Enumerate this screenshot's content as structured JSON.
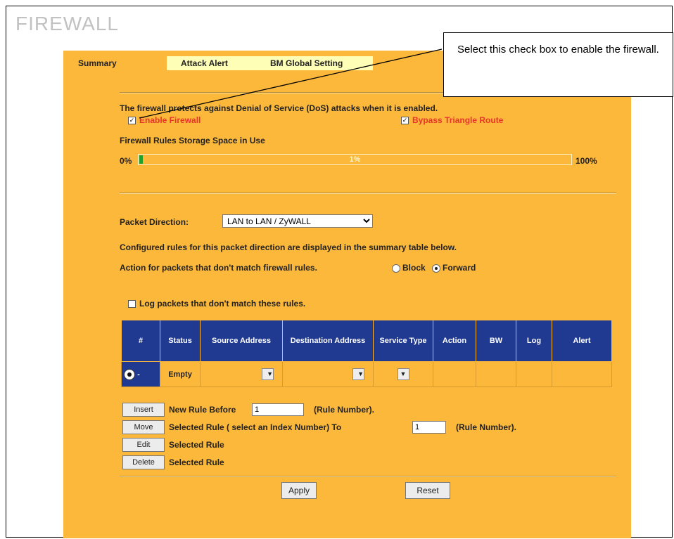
{
  "page_title": "FIREWALL",
  "tabs": [
    {
      "label": "Summary"
    },
    {
      "label": "Attack Alert"
    },
    {
      "label": "BM Global Setting"
    }
  ],
  "intro_text": "The firewall protects against Denial of Service (DoS) attacks when it is enabled.",
  "enable_firewall": {
    "label": "Enable Firewall",
    "checked": true
  },
  "bypass_triangle": {
    "label": "Bypass Triangle Route",
    "checked": true
  },
  "storage": {
    "label": "Firewall Rules Storage Space in Use",
    "min_label": "0%",
    "max_label": "100%",
    "value_text": "1%",
    "value": 1
  },
  "packet_direction": {
    "label": "Packet Direction:",
    "selected": "LAN to LAN / ZyWALL"
  },
  "configured_text": "Configured rules for this packet direction are displayed in the summary table below.",
  "action_text": "Action for packets that don't match firewall rules.",
  "action_options": [
    {
      "label": "Block",
      "selected": false
    },
    {
      "label": "Forward",
      "selected": true
    }
  ],
  "log_packets": {
    "label": "Log packets that don't match these rules.",
    "checked": false
  },
  "table": {
    "headers": [
      "#",
      "Status",
      "Source Address",
      "Destination Address",
      "Service Type",
      "Action",
      "BW",
      "Log",
      "Alert"
    ],
    "row": {
      "dash": "-",
      "status": "Empty"
    }
  },
  "insert": {
    "button": "Insert",
    "text1": "New Rule Before",
    "value": "1",
    "text2": "(Rule Number)."
  },
  "move": {
    "button": "Move",
    "text1": "Selected Rule ( select an Index Number) To",
    "value": "1",
    "text2": "(Rule Number)."
  },
  "edit": {
    "button": "Edit",
    "text": "Selected Rule"
  },
  "delete": {
    "button": "Delete",
    "text": "Selected Rule"
  },
  "apply_label": "Apply",
  "reset_label": "Reset",
  "callout_text": "Select this check box to enable the firewall.",
  "colors": {
    "panel": "#fcb83a",
    "table_header": "#203a91",
    "enable_label": "#e8352c",
    "tab_inactive": "#fffeb6"
  }
}
